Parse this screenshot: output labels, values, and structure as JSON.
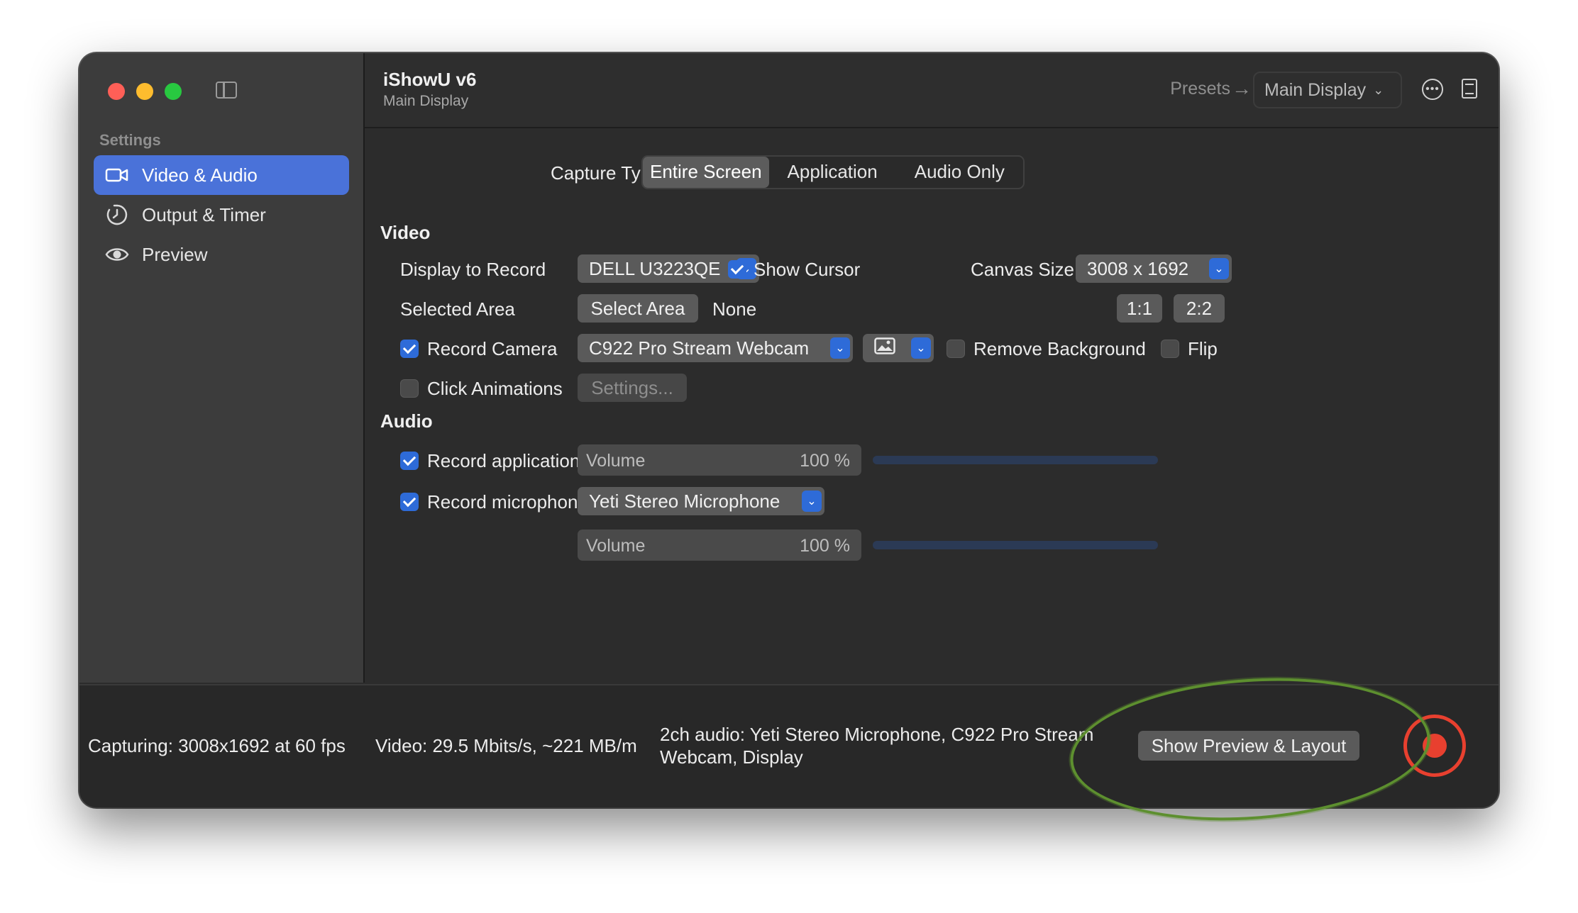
{
  "window": {
    "title": "iShowU v6",
    "subtitle": "Main Display"
  },
  "sidebar": {
    "heading": "Settings",
    "items": [
      {
        "label": "Video & Audio",
        "icon": "video-camera-icon",
        "active": true
      },
      {
        "label": "Output & Timer",
        "icon": "timer-icon",
        "active": false
      },
      {
        "label": "Preview",
        "icon": "eye-icon",
        "active": false
      }
    ]
  },
  "toolbar": {
    "presets_label": "Presets",
    "display_selector": "Main Display"
  },
  "capture_type": {
    "label": "Capture Type",
    "options": [
      "Entire Screen",
      "Application",
      "Audio Only"
    ],
    "selected": "Entire Screen"
  },
  "video": {
    "heading": "Video",
    "display_label": "Display to Record",
    "display_value": "DELL U3223QE",
    "show_cursor_label": "Show Cursor",
    "show_cursor": true,
    "canvas_label": "Canvas Size",
    "canvas_value": "3008 x 1692",
    "selected_area_label": "Selected Area",
    "select_area_button": "Select Area",
    "selected_area_value": "None",
    "scale_1": "1:1",
    "scale_2": "2:2",
    "record_camera_label": "Record Camera",
    "record_camera": true,
    "camera_value": "C922 Pro Stream Webcam",
    "remove_bg_label": "Remove Background",
    "remove_bg": false,
    "flip_label": "Flip",
    "flip": false,
    "click_anim_label": "Click Animations",
    "click_anim": false,
    "settings_button": "Settings..."
  },
  "audio": {
    "heading": "Audio",
    "app_audio_label": "Record application audio",
    "app_audio": true,
    "app_volume_label": "Volume",
    "app_volume_value": "100 %",
    "mic_label": "Record microphone",
    "mic": true,
    "mic_device": "Yeti Stereo Microphone",
    "mic_volume_label": "Volume",
    "mic_volume_value": "100 %"
  },
  "status": {
    "capturing": "Capturing: 3008x1692 at 60 fps",
    "video": "Video: 29.5 Mbits/s, ~221 MB/m",
    "audio_line1": "2ch audio: Yeti Stereo Microphone, C922 Pro Stream",
    "audio_line2": "Webcam, Display"
  },
  "actions": {
    "preview_layout": "Show Preview & Layout",
    "record_icon": "record-icon"
  },
  "colors": {
    "accent": "#2e6bd8",
    "sidebar_selected": "#4a72d9",
    "record": "#e8402f",
    "annotation": "#5d8f2f"
  }
}
